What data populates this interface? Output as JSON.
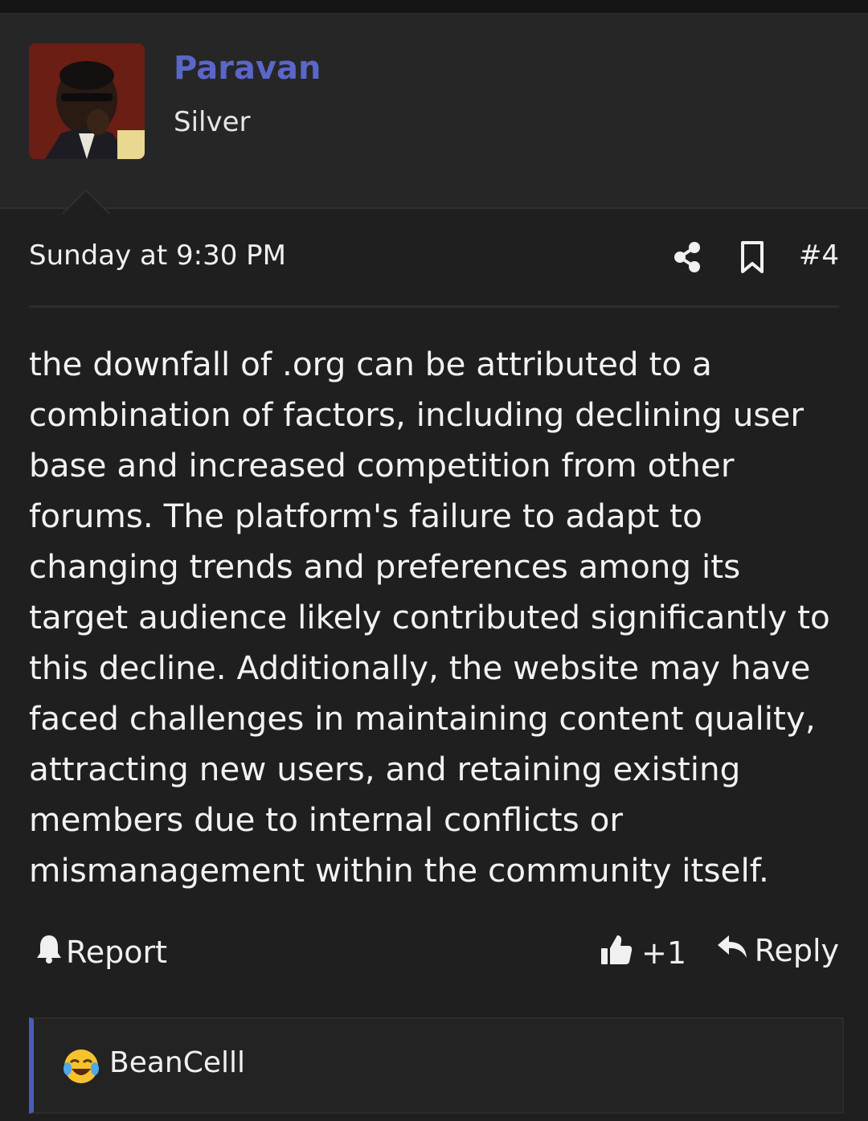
{
  "post": {
    "username": "Paravan",
    "user_title": "Silver",
    "date": "Sunday at 9:30 PM",
    "post_number": "#4",
    "body": "the downfall of .org can be attributed to a combination of factors, including declining user base and increased competition from other forums. The platform's failure to adapt to changing trends and preferences among its target audience likely contributed significantly to this decline. Additionally, the website may have faced challenges in maintaining content quality, attracting new users, and retaining existing members due to internal conflicts or mismanagement within the community itself."
  },
  "actions": {
    "report_label": "Report",
    "like_label": "+1",
    "reply_label": "Reply"
  },
  "reactions": {
    "emoji": "laughing-crying-emoji",
    "user": "BeanCelll"
  },
  "colors": {
    "username": "#5a66c8",
    "accent_bar": "#4f5ab8",
    "background": "#1f1f1f",
    "header_bg": "#262626"
  }
}
